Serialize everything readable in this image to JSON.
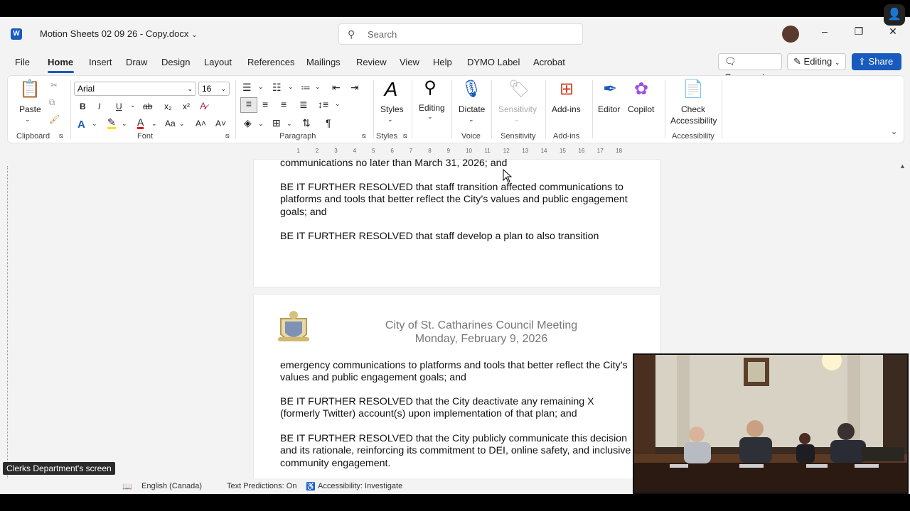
{
  "window": {
    "title": "Motion Sheets 02 09 26 - Copy.docx",
    "search_placeholder": "Search"
  },
  "menu": {
    "items": [
      "File",
      "Home",
      "Insert",
      "Draw",
      "Design",
      "Layout",
      "References",
      "Mailings",
      "Review",
      "View",
      "Help",
      "DYMO Label",
      "Acrobat"
    ],
    "active": "Home",
    "comments_label": "Comments",
    "editing_label": "Editing",
    "share_label": "Share"
  },
  "ribbon": {
    "paste_label": "Paste",
    "font_name": "Arial",
    "font_size": "16",
    "styles_label": "Styles",
    "editing_label": "Editing",
    "dictate_label": "Dictate",
    "sensitivity_label": "Sensitivity",
    "addins_label": "Add-ins",
    "editor_label": "Editor",
    "copilot_label": "Copilot",
    "check_accessibility_line1": "Check",
    "check_accessibility_line2": "Accessibility",
    "groups": {
      "clipboard": "Clipboard",
      "font": "Font",
      "paragraph": "Paragraph",
      "styles": "Styles",
      "voice": "Voice",
      "sensitivity": "Sensitivity",
      "addins": "Add-ins",
      "accessibility": "Accessibility"
    },
    "glyphs": {
      "bold": "B",
      "italic": "I",
      "underline": "U",
      "strike": "ab",
      "subscript": "x₂",
      "superscript": "x²",
      "font_case": "Aa",
      "grow": "A˄",
      "shrink": "A˅",
      "pilcrow": "¶"
    }
  },
  "ruler": {
    "marks": [
      "1",
      "2",
      "3",
      "4",
      "5",
      "6",
      "7",
      "8",
      "9",
      "10",
      "11",
      "12",
      "13",
      "14",
      "15",
      "16",
      "17",
      "18"
    ]
  },
  "document": {
    "page1_paragraphs": [
      "communications no later than March 31, 2026; and",
      "BE IT FURTHER RESOLVED that staff transition affected communications to platforms and tools that better reflect the City’s values and public engagement goals; and",
      "BE IT FURTHER RESOLVED that staff develop a plan to also transition"
    ],
    "header_line1": "City of St. Catharines Council Meeting",
    "header_line2": "Monday, February 9, 2026",
    "page2_paragraphs": [
      "emergency communications to platforms and tools that better reflect the City’s values and public engagement goals; and",
      "BE IT FURTHER RESOLVED that the City deactivate any remaining X (formerly Twitter) account(s) upon implementation of that plan; and",
      "BE IT FURTHER RESOLVED that the City publicly communicate this decision and its rationale, reinforcing its commitment to DEI, online safety, and inclusive community engagement."
    ]
  },
  "statusbar": {
    "screen_label": "Clerks Department's screen",
    "language": "English (Canada)",
    "text_predictions": "Text Predictions: On",
    "accessibility": "Accessibility: Investigate"
  },
  "colors": {
    "accent": "#185abd",
    "ribbon_bg": "#ffffff",
    "window_bg": "#f3f3f3"
  }
}
